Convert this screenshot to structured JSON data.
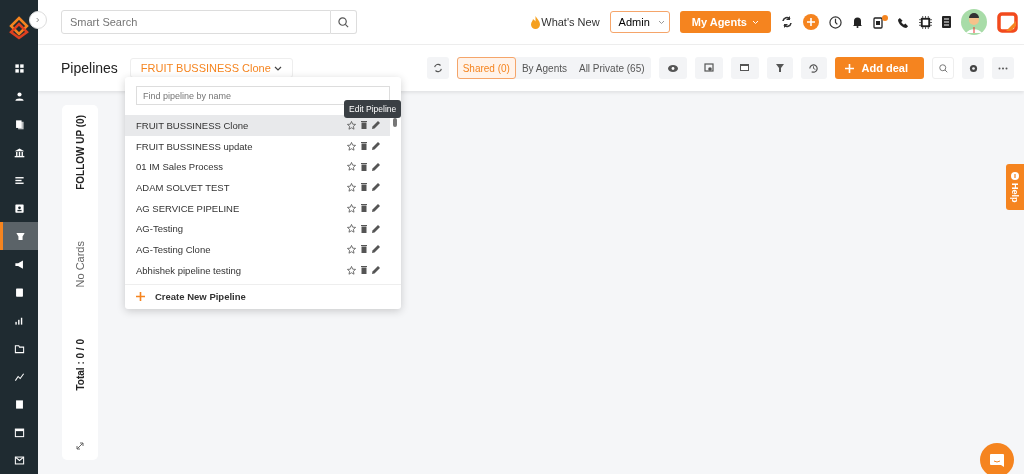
{
  "sidebar": {
    "items": [
      {
        "selected": false
      },
      {
        "selected": false
      },
      {
        "selected": false
      },
      {
        "selected": false
      },
      {
        "selected": false
      },
      {
        "selected": false
      },
      {
        "selected": true
      },
      {
        "selected": false
      },
      {
        "selected": false
      },
      {
        "selected": false
      },
      {
        "selected": false
      },
      {
        "selected": false
      },
      {
        "selected": false
      },
      {
        "selected": false
      },
      {
        "selected": false
      }
    ]
  },
  "topbar": {
    "search": {
      "placeholder": "Smart Search"
    },
    "whats_new": "What's New",
    "role": "Admin",
    "agents_button": "My Agents"
  },
  "header": {
    "title": "Pipelines",
    "pipeline": "FRUIT BUSSINESS Clone",
    "views": [
      {
        "label": "Shared (0)",
        "selected": true
      },
      {
        "label": "By Agents",
        "selected": false
      },
      {
        "label": "All Private (65)",
        "selected": false
      }
    ],
    "add_button": "Add deal"
  },
  "board": {
    "columns": [
      {
        "title": "FOLLOW UP (0)",
        "empty": "No Cards",
        "total": "Total : 0 / 0"
      }
    ]
  },
  "dropdown": {
    "search": {
      "placeholder": "Find pipeline by name"
    },
    "items": [
      {
        "name": "FRUIT BUSSINESS Clone",
        "selected": true
      },
      {
        "name": "FRUIT BUSSINESS update",
        "selected": false
      },
      {
        "name": "01 IM Sales Process",
        "selected": false
      },
      {
        "name": "ADAM SOLVET TEST",
        "selected": false
      },
      {
        "name": "AG SERVICE PIPELINE",
        "selected": false
      },
      {
        "name": "AG-Testing",
        "selected": false
      },
      {
        "name": "AG-Testing Clone",
        "selected": false
      },
      {
        "name": "Abhishek pipeline testing",
        "selected": false
      }
    ],
    "create": "Create New Pipeline",
    "tooltip": "Edit Pipeline"
  },
  "help_tab": "Help"
}
